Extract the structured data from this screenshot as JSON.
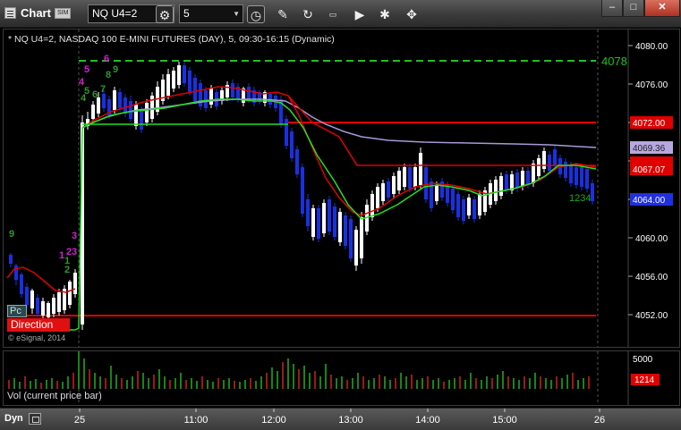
{
  "window": {
    "title": "Chart",
    "sim_badge": "SIM",
    "symbol": "NQ U4=2",
    "interval": "5",
    "min_label": "–",
    "max_label": "□",
    "close_label": "✕"
  },
  "chart": {
    "header": "* NQ U4=2, NASDAQ 100 E-MINI FUTURES (DAY), 5, 09:30-16:15 (Dynamic)",
    "copyright": "© eSignal, 2014",
    "pc_badge": "Pc",
    "direction_badge": "Direction",
    "count_label": "1234",
    "price_levels": [
      "4080.00",
      "4076.00",
      "4072.00",
      "4068.00",
      "4064.00",
      "4060.00",
      "4056.00",
      "4052.00"
    ],
    "level_badges": [
      {
        "text": "4078",
        "color": "#22c022"
      },
      {
        "text": "4072.00",
        "color": "#e00000"
      },
      {
        "text": "4069.36",
        "color": "#b8a8e0"
      },
      {
        "text": "4067.07",
        "color": "#e00000"
      },
      {
        "text": "4064.00",
        "color": "#2030e0"
      }
    ],
    "markers": [
      {
        "text": "5",
        "color": "#d020d0"
      },
      {
        "text": "6",
        "color": "#d020d0"
      },
      {
        "text": "4",
        "color": "#d020d0"
      },
      {
        "text": "5",
        "color": "#2a9a2a"
      },
      {
        "text": "8",
        "color": "#2a9a2a"
      },
      {
        "text": "9",
        "color": "#2a9a2a"
      },
      {
        "text": "6",
        "color": "#2a9a2a"
      },
      {
        "text": "7",
        "color": "#2a9a2a"
      },
      {
        "text": "4",
        "color": "#2a9a2a"
      },
      {
        "text": "9",
        "color": "#2a9a2a"
      },
      {
        "text": "3",
        "color": "#d020d0"
      },
      {
        "text": "1",
        "color": "#d020d0"
      },
      {
        "text": "2",
        "color": "#d020d0"
      },
      {
        "text": "3",
        "color": "#d020d0"
      },
      {
        "text": "2",
        "color": "#2a9a2a"
      },
      {
        "text": "1",
        "color": "#2a9a2a"
      }
    ]
  },
  "volume": {
    "label": "Vol (current price bar)",
    "scale_label": "5000",
    "current_value": "1214"
  },
  "time_axis": {
    "labels": [
      "25",
      "11:00",
      "12:00",
      "13:00",
      "14:00",
      "15:00",
      "26"
    ]
  },
  "bottom": {
    "dyn_label": "Dyn"
  },
  "colors": {
    "up_bar": "#ffffff",
    "down_bar": "#1a30e0",
    "sma_fast": "#e00000",
    "sma_green": "#22e022",
    "vwap": "#a898d8",
    "level_red": "#e00000",
    "level_green": "#22c022"
  }
}
